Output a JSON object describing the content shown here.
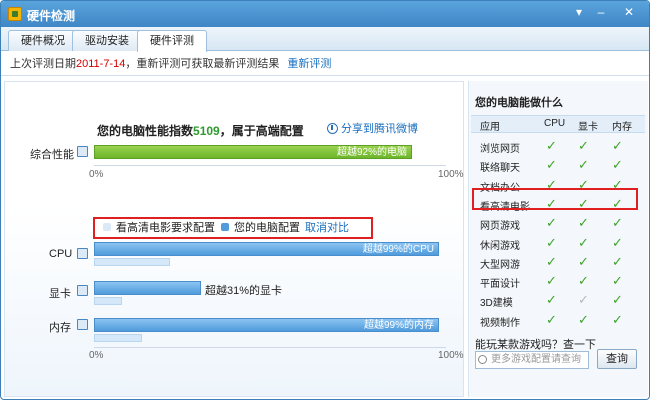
{
  "window": {
    "title": "硬件检测",
    "menu_icon": "dropdown-arrow-icon",
    "min_icon": "minimize-icon",
    "close_icon": "close-icon"
  },
  "tabs": [
    {
      "label": "硬件概况",
      "active": false
    },
    {
      "label": "驱动安装",
      "active": false
    },
    {
      "label": "硬件评测",
      "active": true
    }
  ],
  "info": {
    "prefix": "上次评测日期",
    "date": "2011-7-14",
    "suffix": "，重新评测可获取最新评测结果",
    "relink": "重新评测"
  },
  "score": {
    "prefix": "您的电脑性能指数",
    "value": "5109",
    "suffix": "，属于高端配置",
    "share": "分享到腾讯微博"
  },
  "overall": {
    "label": "综合性能",
    "bar_text": "超越92%的电脑",
    "percent": 92
  },
  "axis": {
    "min": "0%",
    "max": "100%"
  },
  "legend": {
    "item1": "看高清电影要求配置",
    "item2": "您的电脑配置",
    "cancel": "取消对比"
  },
  "components": [
    {
      "label": "CPU",
      "text": "超越99%的CPU",
      "percent": 99,
      "required_percent": 21
    },
    {
      "label": "显卡",
      "text": "超越31%的显卡",
      "percent": 31,
      "required_percent": 8
    },
    {
      "label": "内存",
      "text": "超越99%的内存",
      "percent": 99,
      "required_percent": 14
    }
  ],
  "right": {
    "title": "您的电脑能做什么",
    "headers": [
      "应用",
      "CPU",
      "显卡",
      "内存"
    ],
    "rows": [
      {
        "name": "浏览网页",
        "cpu": true,
        "gpu": true,
        "mem": true
      },
      {
        "name": "联络聊天",
        "cpu": true,
        "gpu": true,
        "mem": true
      },
      {
        "name": "文档办公",
        "cpu": true,
        "gpu": true,
        "mem": true
      },
      {
        "name": "看高清电影",
        "cpu": true,
        "gpu": true,
        "mem": true
      },
      {
        "name": "网页游戏",
        "cpu": true,
        "gpu": true,
        "mem": true
      },
      {
        "name": "休闲游戏",
        "cpu": true,
        "gpu": true,
        "mem": true
      },
      {
        "name": "大型网游",
        "cpu": true,
        "gpu": true,
        "mem": true
      },
      {
        "name": "平面设计",
        "cpu": true,
        "gpu": true,
        "mem": true
      },
      {
        "name": "3D建模",
        "cpu": true,
        "gpu": false,
        "mem": true
      },
      {
        "name": "视频制作",
        "cpu": true,
        "gpu": true,
        "mem": true
      }
    ],
    "ask": "能玩某款游戏吗？查一下",
    "search_placeholder": "更多游戏配置请查询",
    "search_button": "查询"
  },
  "colors": {
    "check": "#3ca228",
    "check_partial": "#b7b7b7",
    "highlight": "#e02020",
    "date": "#d40000"
  }
}
